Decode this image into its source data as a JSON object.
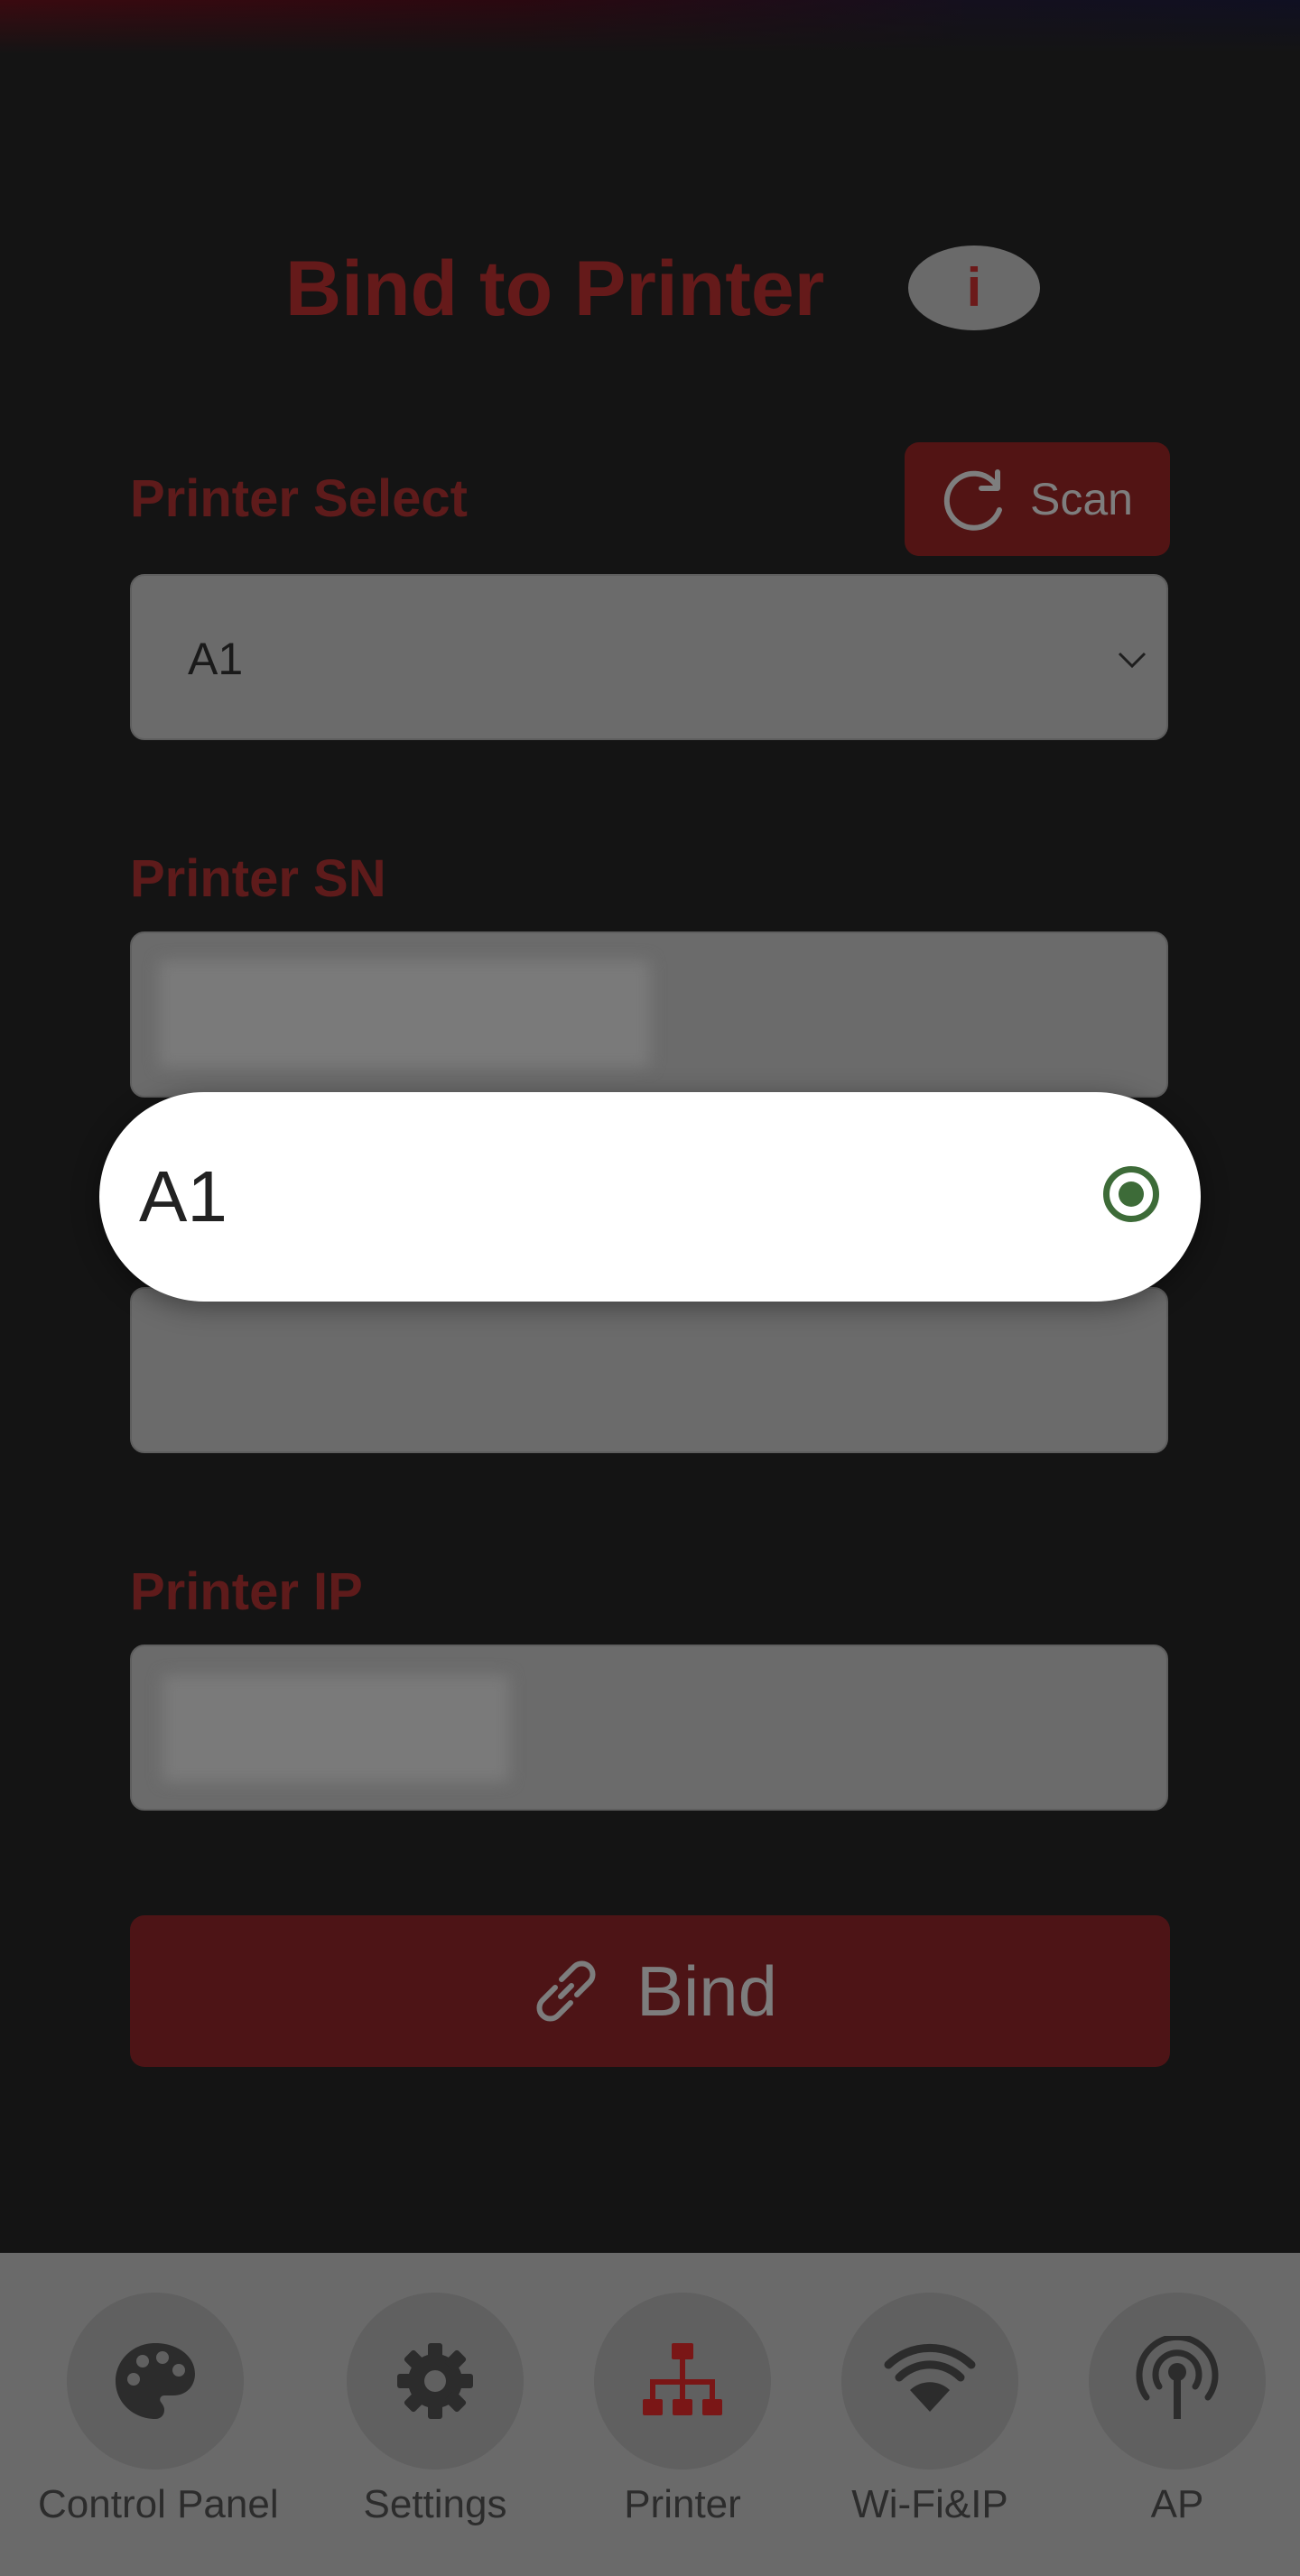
{
  "header": {
    "title": "Bind to Printer",
    "info_glyph": "i"
  },
  "printer_select": {
    "label": "Printer Select",
    "scan_label": "Scan",
    "selected_value": "A1"
  },
  "printer_sn": {
    "label": "Printer SN",
    "value": ""
  },
  "printer_ip": {
    "label": "Printer IP",
    "value": ""
  },
  "bind_button": {
    "label": "Bind"
  },
  "dropdown_popup": {
    "options": [
      {
        "label": "A1",
        "selected": true
      }
    ]
  },
  "bottom_nav": {
    "items": [
      {
        "label": "Control Panel",
        "icon": "palette-icon",
        "active": false
      },
      {
        "label": "Settings",
        "icon": "gear-icon",
        "active": false
      },
      {
        "label": "Printer",
        "icon": "network-tree-icon",
        "active": true
      },
      {
        "label": "Wi-Fi&IP",
        "icon": "wifi-icon",
        "active": false
      },
      {
        "label": "AP",
        "icon": "antenna-icon",
        "active": false
      }
    ]
  },
  "colors": {
    "accent": "#c62828",
    "background": "#141414",
    "popup_background": "#ffffff",
    "radio_selected": "#3d6b38"
  }
}
